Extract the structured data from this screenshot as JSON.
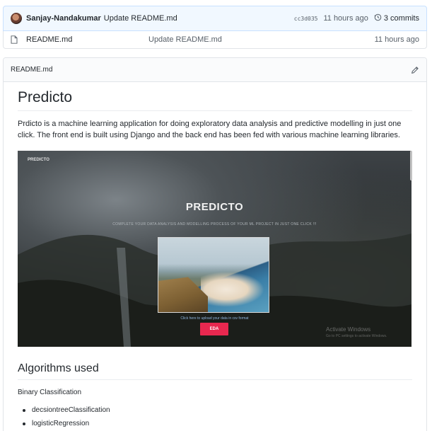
{
  "commit": {
    "author": "Sanjay-Nandakumar",
    "message": "Update README.md",
    "sha": "cc3d035",
    "age": "11 hours ago",
    "commits_count": "3 commits"
  },
  "files": [
    {
      "name": "README.md",
      "message": "Update README.md",
      "age": "11 hours ago"
    }
  ],
  "readme": {
    "header_title": "README.md",
    "title": "Predicto",
    "description": "Prdicto is a machine learning application for doing exploratory data analysis and predictive modelling in just one click. The front end is built using Django and the back end has been fed with various machine learning libraries.",
    "screenshot": {
      "logo": "PREDICTO",
      "heading": "PREDICTO",
      "subtitle": "COMPLETE YOUR DATA ANALYSIS AND MODELLING PROCESS OF YOUR ML PROJECT IN JUST ONE CLICK !!!",
      "upload_text": "Click here to upload your data in csv format",
      "button_label": "EDA",
      "watermark": "Activate Windows",
      "watermark_sub": "Go to PC settings to activate Windows."
    },
    "section_title": "Algorithms used",
    "subsection": "Binary Classification",
    "algorithms": [
      "decsiontreeClassification",
      "logisticRegression"
    ]
  },
  "icons": {
    "history": "history-icon",
    "file": "file-icon",
    "edit": "pencil-icon"
  },
  "colors": {
    "commit_bar_bg": "#f1f8ff",
    "accent_button": "#e8284f"
  }
}
